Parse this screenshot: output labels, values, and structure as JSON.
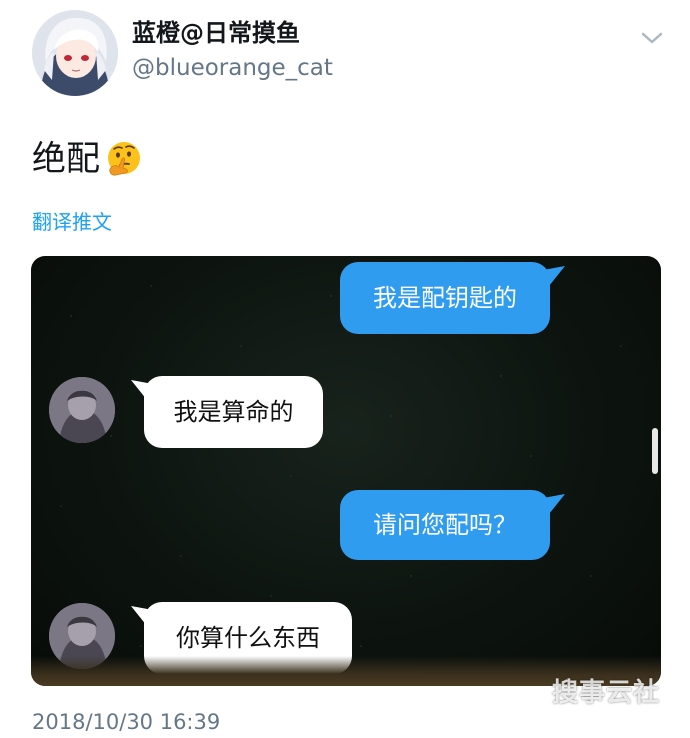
{
  "author": {
    "display_name": "蓝橙@日常摸鱼",
    "handle": "@blueorange_cat"
  },
  "tweet": {
    "text": "绝配",
    "emoji": "thinking-face",
    "translate_label": "翻译推文",
    "timestamp": "2018/10/30 16:39"
  },
  "chat": {
    "messages": [
      {
        "side": "outgoing",
        "text": "我是配钥匙的"
      },
      {
        "side": "incoming",
        "text": "我是算命的"
      },
      {
        "side": "outgoing",
        "text": "请问您配吗？"
      },
      {
        "side": "incoming",
        "text": "你算什么东西"
      }
    ]
  },
  "watermark": "搜事云社",
  "colors": {
    "outgoing_bubble": "#2f9cf0",
    "incoming_bubble": "#ffffff",
    "link": "#1da1f2",
    "secondary_text": "#657786"
  },
  "icons": {
    "menu": "chevron-down-icon"
  }
}
